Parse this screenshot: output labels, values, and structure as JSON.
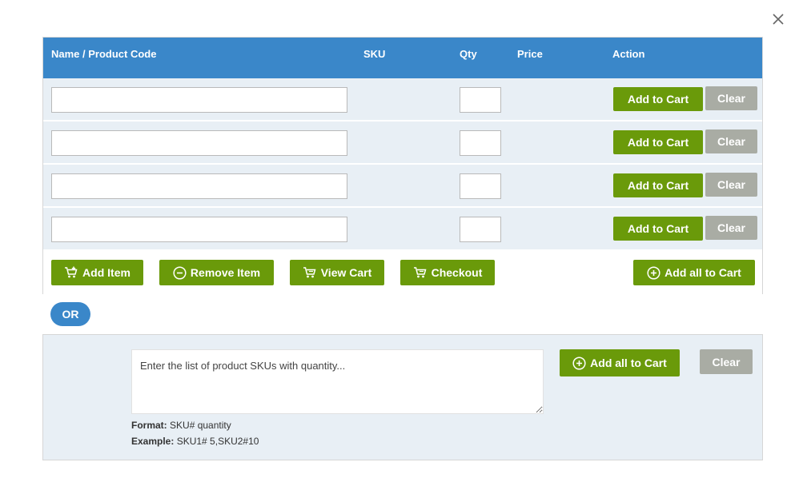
{
  "header": {
    "name": "Name / Product Code",
    "sku": "SKU",
    "qty": "Qty",
    "price": "Price",
    "action": "Action"
  },
  "rows": [
    {
      "name_value": "",
      "qty_value": "",
      "add_label": "Add to Cart",
      "clear_label": "Clear"
    },
    {
      "name_value": "",
      "qty_value": "",
      "add_label": "Add to Cart",
      "clear_label": "Clear"
    },
    {
      "name_value": "",
      "qty_value": "",
      "add_label": "Add to Cart",
      "clear_label": "Clear"
    },
    {
      "name_value": "",
      "qty_value": "",
      "add_label": "Add to Cart",
      "clear_label": "Clear"
    }
  ],
  "footer": {
    "add_item": "Add Item",
    "remove_item": "Remove Item",
    "view_cart": "View Cart",
    "checkout": "Checkout",
    "add_all": "Add all to Cart"
  },
  "or_label": "OR",
  "bulk": {
    "placeholder": "Enter the list of product SKUs with quantity...",
    "add_all": "Add all to Cart",
    "clear": "Clear",
    "format_label": "Format:",
    "format_value": "SKU# quantity",
    "example_label": "Example:",
    "example_value": "SKU1# 5,SKU2#10"
  },
  "icons": {
    "close": "close-icon",
    "cart_add": "cart-plus-icon",
    "remove": "minus-circle-icon",
    "cart": "cart-icon",
    "plus_circle": "plus-circle-icon"
  },
  "colors": {
    "header_blue": "#3a87c9",
    "button_green": "#6a9a0a",
    "button_gray": "#a9aca4",
    "row_bg": "#e8eff5"
  }
}
